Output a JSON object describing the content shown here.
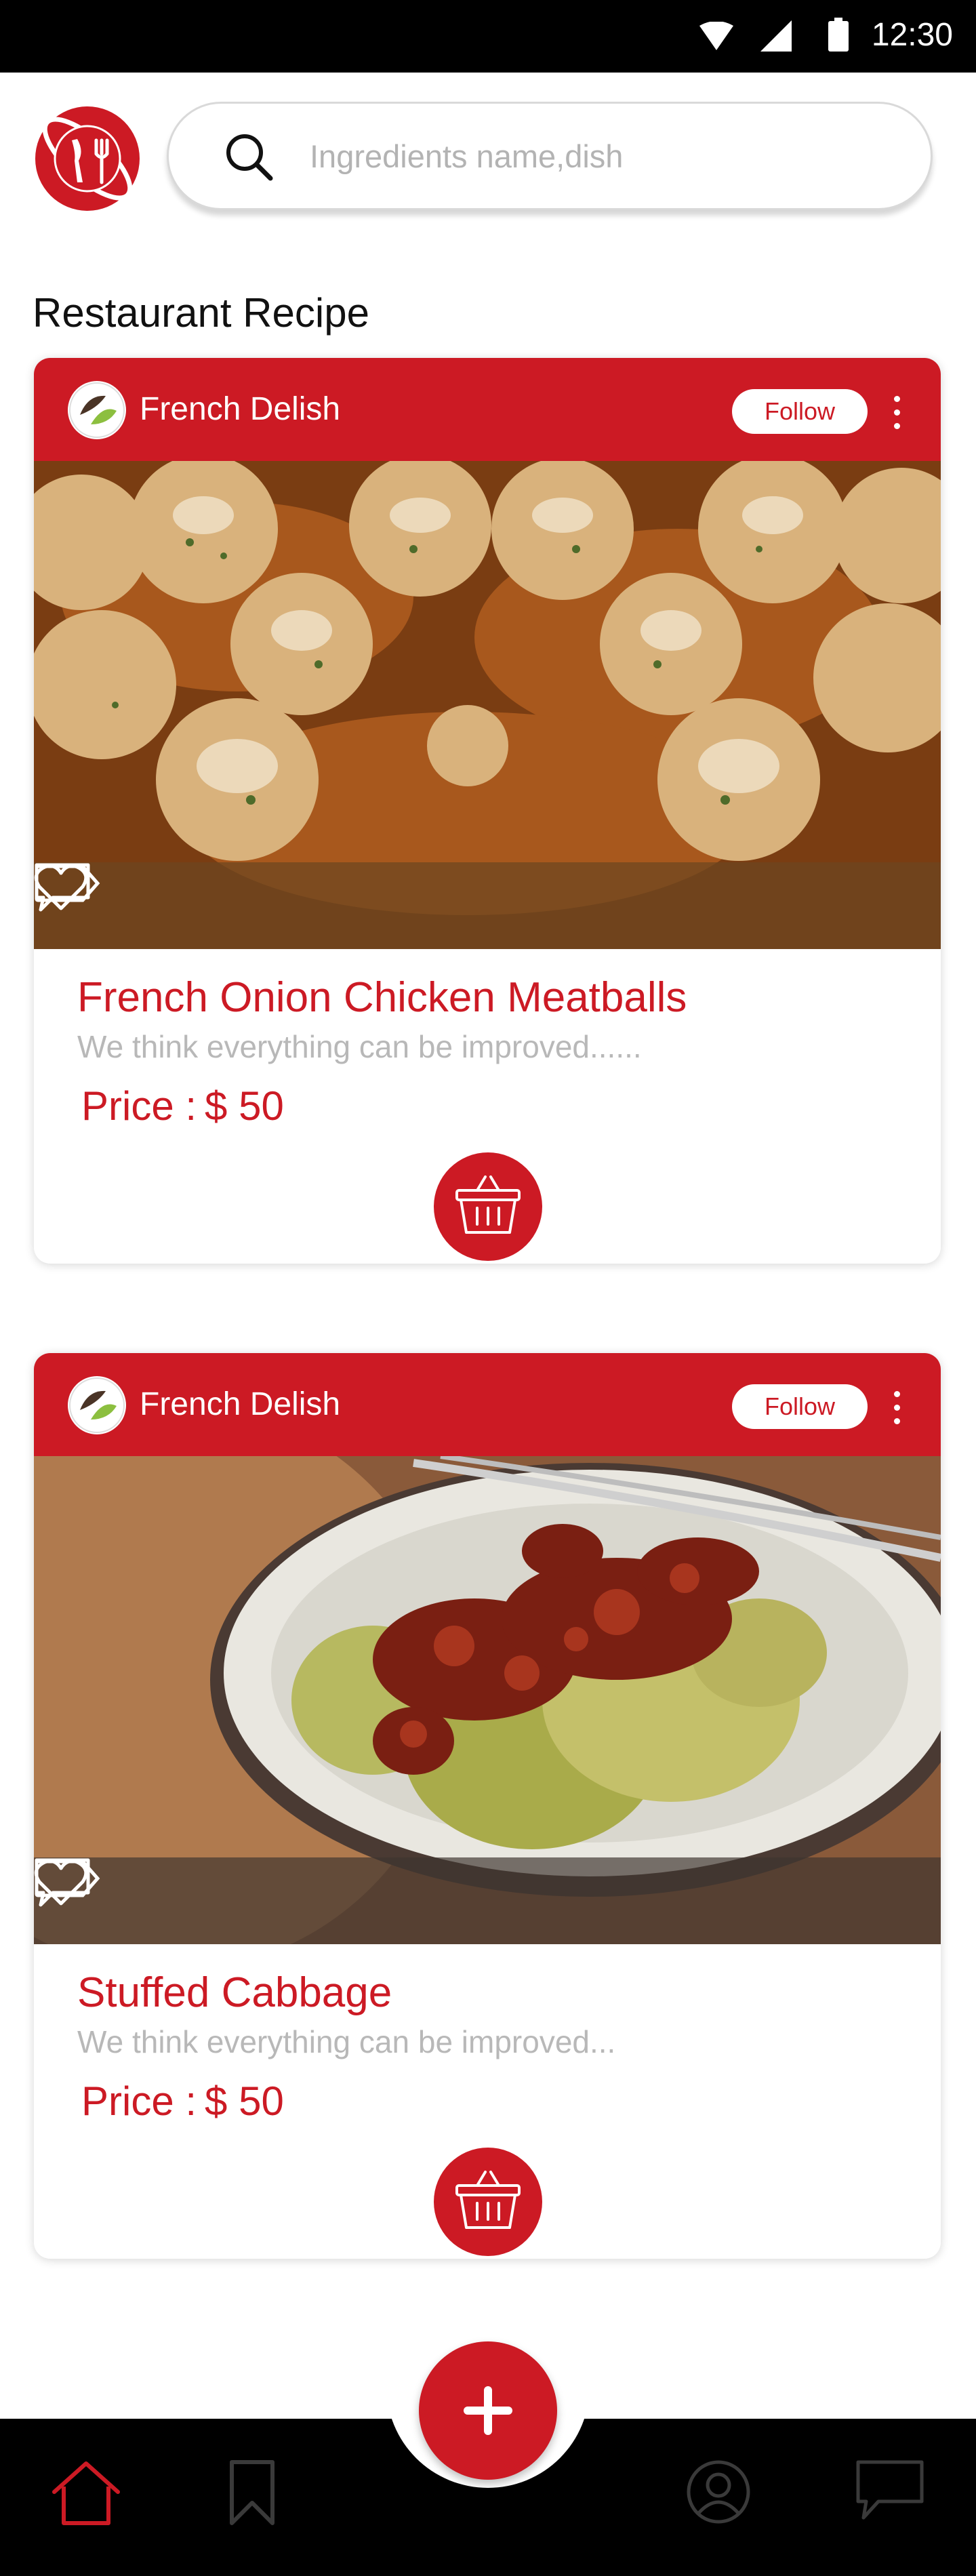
{
  "status_bar": {
    "time": "12:30"
  },
  "search": {
    "placeholder": "Ingredients name,dish"
  },
  "section": {
    "title": "Restaurant Recipe"
  },
  "colors": {
    "brand_red": "#cc1a24",
    "nav_background": "#000000",
    "placeholder_gray": "#b3b3b3"
  },
  "recipes": [
    {
      "chef": "French Delish",
      "follow_label": "Follow",
      "title": "French Onion Chicken Meatballs",
      "description": "We think everything can be improved......",
      "price_label": "Price :",
      "price_value": "$ 50",
      "photo": "meatballs-photo",
      "actions": [
        "tag-icon",
        "heart-icon",
        "comment-icon",
        "basket-icon"
      ]
    },
    {
      "chef": "French Delish",
      "follow_label": "Follow",
      "title": "Stuffed Cabbage",
      "description": "We think everything can be improved...",
      "price_label": "Price :",
      "price_value": "$ 50",
      "photo": "stuffed-cabbage-photo",
      "actions": [
        "tag-icon",
        "heart-icon",
        "comment-icon",
        "basket-icon"
      ]
    }
  ],
  "bottom_nav": {
    "items": [
      "home-icon",
      "bookmark-icon",
      "add-icon",
      "profile-icon",
      "chat-icon"
    ],
    "active": "home-icon"
  }
}
